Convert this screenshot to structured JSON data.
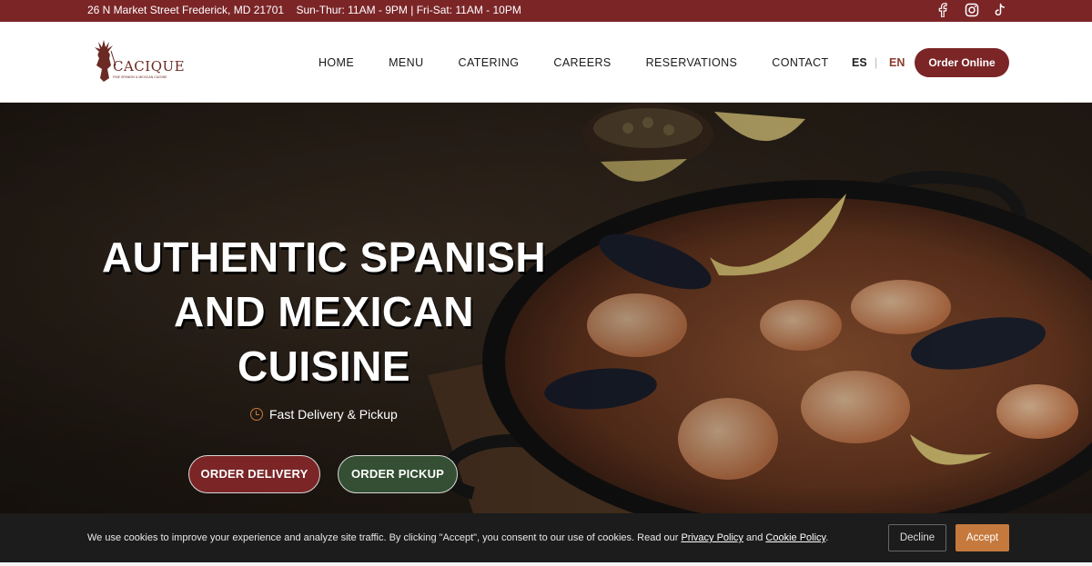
{
  "topbar": {
    "address": "26 N Market Street Frederick, MD 21701",
    "hours": "Sun-Thur: 11AM - 9PM | Fri-Sat: 11AM - 10PM",
    "social": [
      "facebook-icon",
      "instagram-icon",
      "tiktok-icon"
    ]
  },
  "header": {
    "logo": {
      "name": "CACIQUE",
      "tagline": "FINE SPANISH & MEXICAN CUISINE"
    },
    "nav": [
      "HOME",
      "MENU",
      "CATERING",
      "CAREERS",
      "RESERVATIONS",
      "CONTACT"
    ],
    "lang": {
      "es": "ES",
      "separator": "|",
      "en": "EN"
    },
    "order_online": "Order Online"
  },
  "hero": {
    "headline": [
      "AUTHENTIC SPANISH",
      "AND MEXICAN",
      "CUISINE"
    ],
    "delivery_note": "Fast Delivery & Pickup",
    "order_delivery": "ORDER DELIVERY",
    "order_pickup": "ORDER PICKUP"
  },
  "cookie": {
    "text": "We use cookies to improve your experience and analyze site traffic. By clicking \"Accept\", you consent to our use of cookies. Read our",
    "privacy_link": "Privacy Policy",
    "and": "and",
    "cookie_link": "Cookie Policy",
    "period": ".",
    "decline": "Decline",
    "accept": "Accept"
  },
  "colors": {
    "brand_maroon": "#7b2527",
    "pickup_green": "#344f33",
    "accept_orange": "#c6793d",
    "cookie_bg": "#1c1c1c"
  }
}
